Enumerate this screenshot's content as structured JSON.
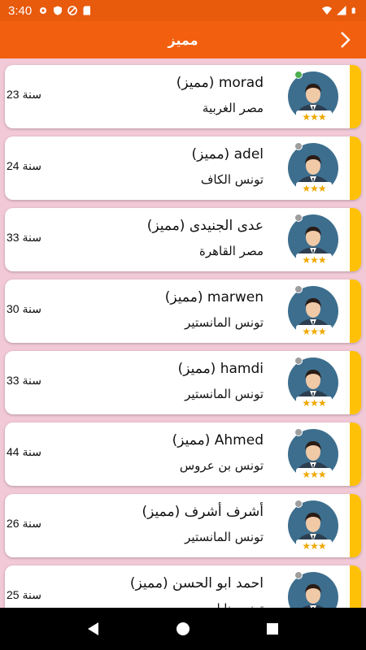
{
  "status": {
    "time": "3:40",
    "icons": [
      "gear-icon",
      "shield-icon",
      "blocked-icon",
      "sd-card-icon"
    ],
    "right_icons": [
      "wifi-icon",
      "signal-icon",
      "battery-icon"
    ]
  },
  "header": {
    "title": "مميز"
  },
  "colors": {
    "primary": "#f2600f",
    "accent": "#ffc107",
    "background": "#f2c9d6",
    "online": "#4caf50",
    "offline": "#9e9e9e"
  },
  "users": [
    {
      "name": "morad (مميز)",
      "location": "مصر الغربية",
      "age": "23 سنة",
      "online": true,
      "stars": "★★★"
    },
    {
      "name": "adel (مميز)",
      "location": "تونس الكاف",
      "age": "24 سنة",
      "online": false,
      "stars": "★★★"
    },
    {
      "name": "عدى الجنيدى (مميز)",
      "location": "مصر القاهرة",
      "age": "33 سنة",
      "online": false,
      "stars": "★★★"
    },
    {
      "name": "marwen (مميز)",
      "location": "تونس المانستير",
      "age": "30 سنة",
      "online": false,
      "stars": "★★★"
    },
    {
      "name": "hamdi (مميز)",
      "location": "تونس المانستير",
      "age": "33 سنة",
      "online": false,
      "stars": "★★★"
    },
    {
      "name": "Ahmed (مميز)",
      "location": "تونس بن عروس",
      "age": "44 سنة",
      "online": false,
      "stars": "★★★"
    },
    {
      "name": "أشرف أشرف (مميز)",
      "location": "تونس المانستير",
      "age": "26 سنة",
      "online": false,
      "stars": "★★★"
    },
    {
      "name": "احمد ابو الحسن (مميز)",
      "location": "تونس نابل",
      "age": "25 سنة",
      "online": false,
      "stars": "★★★"
    }
  ]
}
